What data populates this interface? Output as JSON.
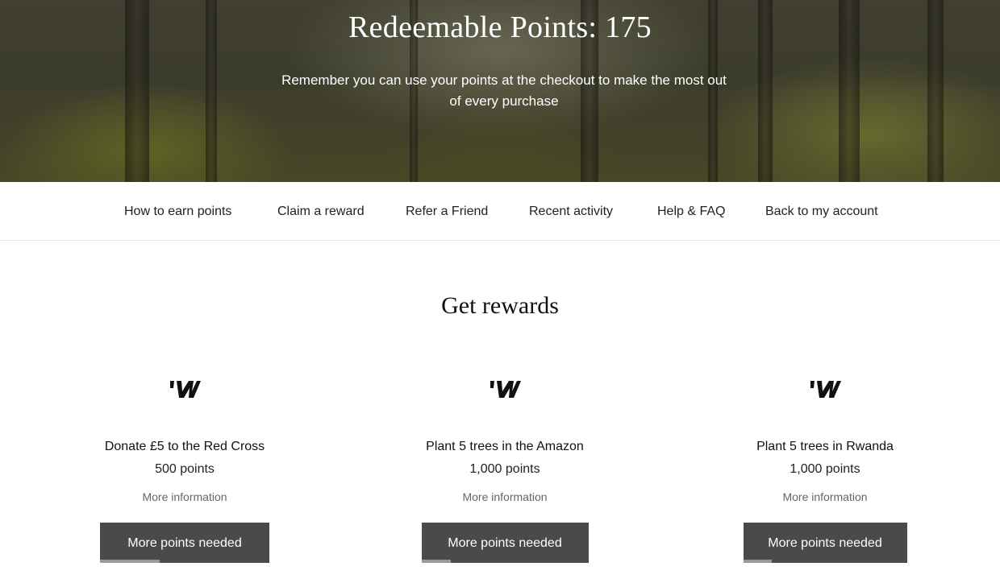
{
  "hero": {
    "title": "Redeemable Points: 175",
    "subtitle": "Remember you can use your points at the checkout to make the most out of every purchase"
  },
  "nav": {
    "items": [
      {
        "label": "How to earn points"
      },
      {
        "label": "Claim a reward"
      },
      {
        "label": "Refer a Friend"
      },
      {
        "label": "Recent activity"
      },
      {
        "label": "Help & FAQ"
      },
      {
        "label": "Back to my account"
      }
    ]
  },
  "rewards": {
    "title": "Get rewards",
    "logo_icon": "brand-w-logo",
    "items": [
      {
        "name": "Donate £5 to the Red Cross",
        "points": "500 points",
        "more_info": "More information",
        "button": "More points needed",
        "progress": 0.35
      },
      {
        "name": "Plant 5 trees in the Amazon",
        "points": "1,000 points",
        "more_info": "More information",
        "button": "More points needed",
        "progress": 0.175
      },
      {
        "name": "Plant 5 trees in Rwanda",
        "points": "1,000 points",
        "more_info": "More information",
        "button": "More points needed",
        "progress": 0.175
      }
    ]
  },
  "colors": {
    "button_bg": "#4a4a4a",
    "progress_fill": "#9a9a9a"
  }
}
